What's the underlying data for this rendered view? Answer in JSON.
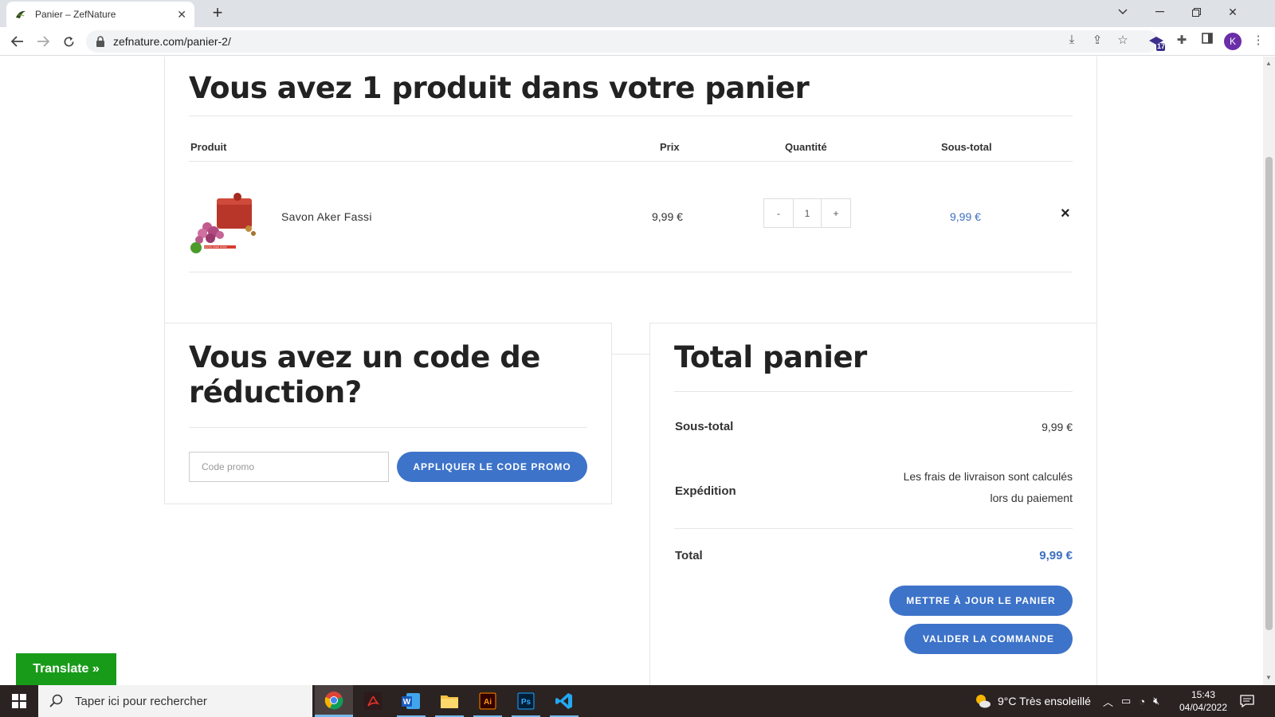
{
  "browser": {
    "tab_title": "Panier – ZefNature",
    "url": "zefnature.com/panier-2/",
    "extension_badge": "17",
    "profile_initial": "K"
  },
  "cart": {
    "heading": "Vous avez 1 produit dans votre panier",
    "columns": {
      "product": "Produit",
      "price": "Prix",
      "quantity": "Quantité",
      "subtotal": "Sous-total"
    },
    "items": [
      {
        "name": "Savon Aker Fassi",
        "price": "9,99 €",
        "quantity": "1",
        "subtotal": "9,99 €",
        "image_label": "SAVON AKER FASSI"
      }
    ],
    "qty_minus": "-",
    "qty_plus": "+",
    "remove": "×"
  },
  "promo": {
    "heading_line1": "Vous avez un code de",
    "heading_line2": "réduction?",
    "placeholder": "Code promo",
    "apply_label": "APPLIQUER LE CODE PROMO"
  },
  "totals": {
    "heading": "Total panier",
    "subtotal_label": "Sous-total",
    "subtotal_value": "9,99 €",
    "shipping_label": "Expédition",
    "shipping_line1": "Les frais de livraison sont calculés",
    "shipping_line2": "lors du paiement",
    "total_label": "Total",
    "total_value": "9,99 €",
    "update_label": "METTRE À JOUR LE PANIER",
    "checkout_label": "VALIDER LA COMMANDE"
  },
  "translate_label": "Translate »",
  "taskbar": {
    "search_placeholder": "Taper ici pour rechercher",
    "weather": "9°C  Très ensoleillé",
    "time": "15:43",
    "date": "04/04/2022"
  },
  "colors": {
    "accent": "#3d73c9",
    "translate": "#199b1a",
    "taskbar": "#2b2322"
  }
}
